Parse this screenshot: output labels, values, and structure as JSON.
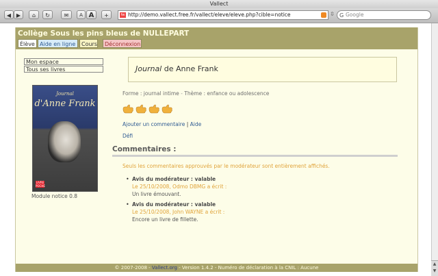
{
  "window": {
    "title": "Vallect"
  },
  "toolbar": {
    "back_label": "◀",
    "forward_label": "▶",
    "home_label": "⌂",
    "reload_label": "↻",
    "screenshot_label": "✉",
    "font_small_label": "A",
    "font_large_label": "A",
    "add_label": "+",
    "url": "http://demo.vallect.free.fr/vallect/eleve/eleve.php?cible=notice",
    "search_placeholder": "Google"
  },
  "site": {
    "title": "Collège Sous les pins bleus de NULLEPART",
    "tabs": [
      {
        "label": "Élève"
      },
      {
        "label": "Aide en ligne"
      },
      {
        "label": "Cours"
      },
      {
        "label": "Déconnexion"
      }
    ],
    "sidebar": {
      "items": [
        {
          "label": "Mon espace"
        },
        {
          "label": "Tous ses livres"
        }
      ],
      "cover": {
        "line1": "Journal",
        "line2": "d'Anne Frank"
      },
      "module_label": "Module notice 0.8"
    },
    "book": {
      "title_italic": "Journal",
      "title_rest": " de Anne Frank",
      "forme": "Forme : journal intime",
      "theme": "Thème : enfance ou adolescence",
      "rating": 4,
      "add_comment": "Ajouter un commentaire",
      "help": "Aide",
      "defi": "Défi"
    },
    "comments": {
      "heading": "Commentaires :",
      "note": "Seuls les commentaires approuvés par le modérateur sont entièrement affichés.",
      "items": [
        {
          "title": "Avis du modérateur : valable",
          "meta": "Le 25/10/2008, Odmo DBMG a écrit :",
          "text": "Un livre émouvant."
        },
        {
          "title": "Avis du modérateur : valable",
          "meta": "Le 25/10/2008, John WAYNE a écrit :",
          "text": "Encore un livre de fillette."
        }
      ]
    },
    "footer": {
      "left": "© 2007-2008 - ",
      "link": "Vallect.org",
      "right": " - Version 1.4.2 - Numéro de déclaration à la CNIL : Aucune"
    }
  },
  "colors": {
    "header_bg": "#a8a36a",
    "page_bg": "#fdfde8",
    "link": "#2f5b93",
    "accent": "#e0a33a"
  }
}
